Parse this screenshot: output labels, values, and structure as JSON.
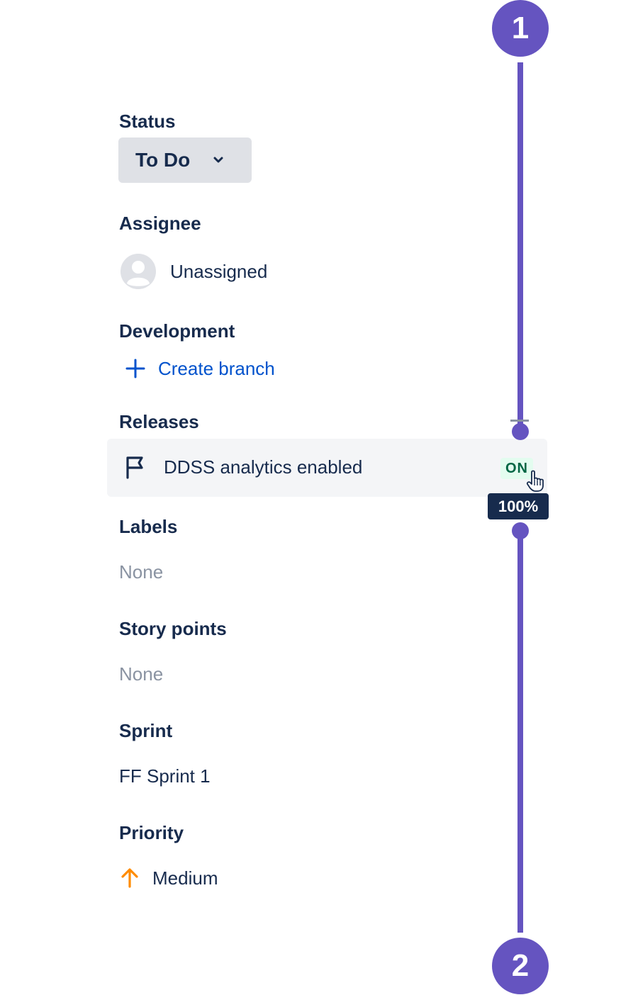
{
  "status": {
    "label": "Status",
    "value": "To Do"
  },
  "assignee": {
    "label": "Assignee",
    "value": "Unassigned"
  },
  "development": {
    "label": "Development",
    "action": "Create branch"
  },
  "releases": {
    "label": "Releases",
    "flag_name": "DDSS analytics enabled",
    "flag_state": "ON",
    "rollout_tooltip": "100%"
  },
  "labels": {
    "label": "Labels",
    "value": "None"
  },
  "story_points": {
    "label": "Story points",
    "value": "None"
  },
  "sprint": {
    "label": "Sprint",
    "value": "FF Sprint 1"
  },
  "priority": {
    "label": "Priority",
    "value": "Medium"
  },
  "callouts": {
    "first": "1",
    "second": "2"
  },
  "colors": {
    "callout": "#6554c0",
    "link": "#0052cc",
    "on_badge_text": "#006644",
    "priority_medium": "#ff8b00"
  }
}
